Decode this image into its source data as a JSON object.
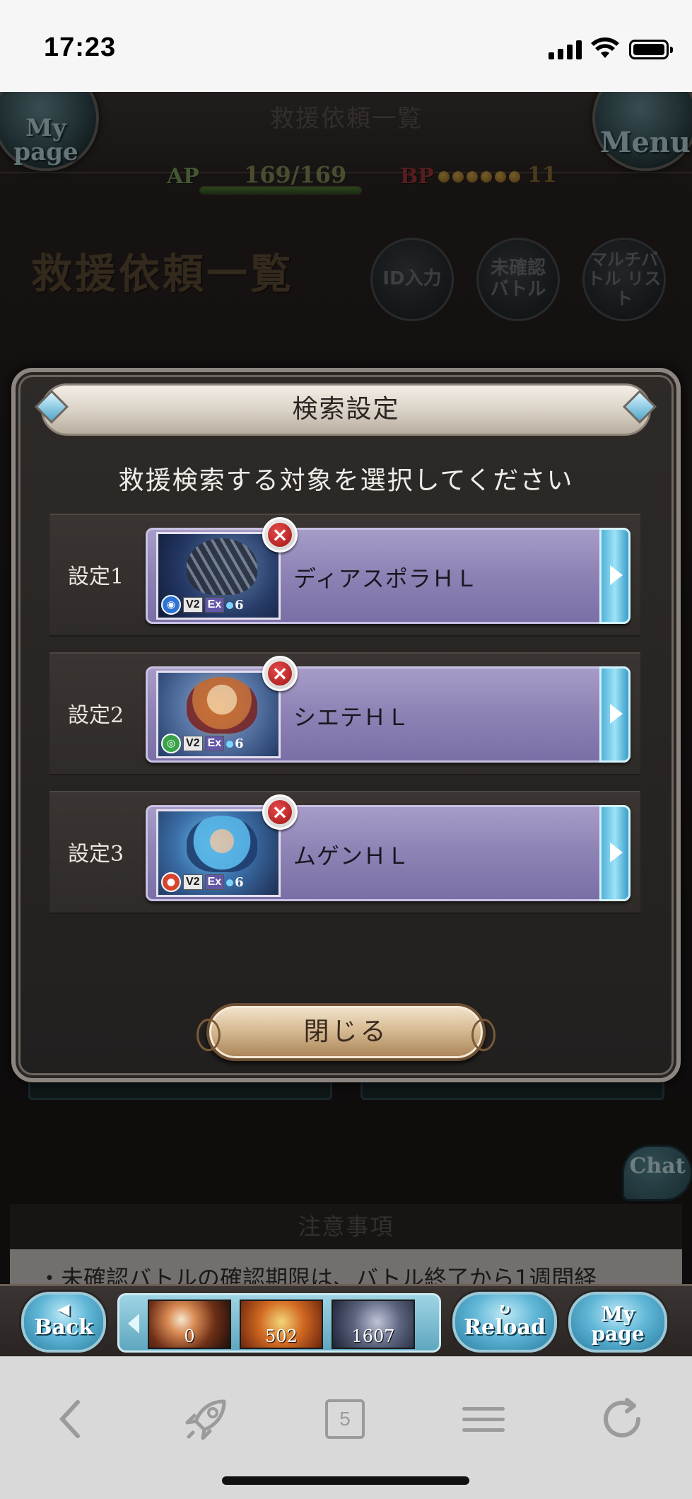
{
  "status_bar": {
    "time": "17:23"
  },
  "game_header": {
    "page_title": "救援依頼一覧",
    "mypage_orb": "My page",
    "menu_orb": "Menu",
    "ap_label": "AP",
    "ap_value": "169/169",
    "ap_fill": 1.0,
    "bp_label": "BP",
    "bp_value": "11"
  },
  "rescue_page": {
    "title": "救援依頼一覧",
    "buttons": {
      "id_input": "ID入力",
      "unconfirmed": "未確認 バトル",
      "multi_list": "マルチバトル リスト"
    },
    "notice_head": "注意事項",
    "notice_body": "・未確認バトルの確認期限は、バトル終了から1週間経"
  },
  "chat": {
    "label": "Chat"
  },
  "modal": {
    "title": "検索設定",
    "subtitle": "救援検索する対象を選択してください",
    "rows": [
      {
        "label": "設定1",
        "name": "ディアスポラＨＬ",
        "element": "water",
        "tag_v2": "V2",
        "tag_ex": "Ex",
        "players": "6"
      },
      {
        "label": "設定2",
        "name": "シエテＨＬ",
        "element": "wind",
        "tag_v2": "V2",
        "tag_ex": "Ex",
        "players": "6"
      },
      {
        "label": "設定3",
        "name": "ムゲンＨＬ",
        "element": "fire",
        "tag_v2": "V2",
        "tag_ex": "Ex",
        "players": "6"
      }
    ],
    "close_label": "閉じる"
  },
  "game_nav": {
    "back": "Back",
    "reload": "Reload",
    "mypage": "My page",
    "items": [
      {
        "count": "0"
      },
      {
        "count": "502"
      },
      {
        "count": "1607"
      }
    ]
  },
  "safari": {
    "tab_count": "5"
  },
  "colors": {
    "card_purple": "#8f84b6",
    "arrow_blue": "#4fb3d8",
    "close_gold": "#d7bc94"
  }
}
